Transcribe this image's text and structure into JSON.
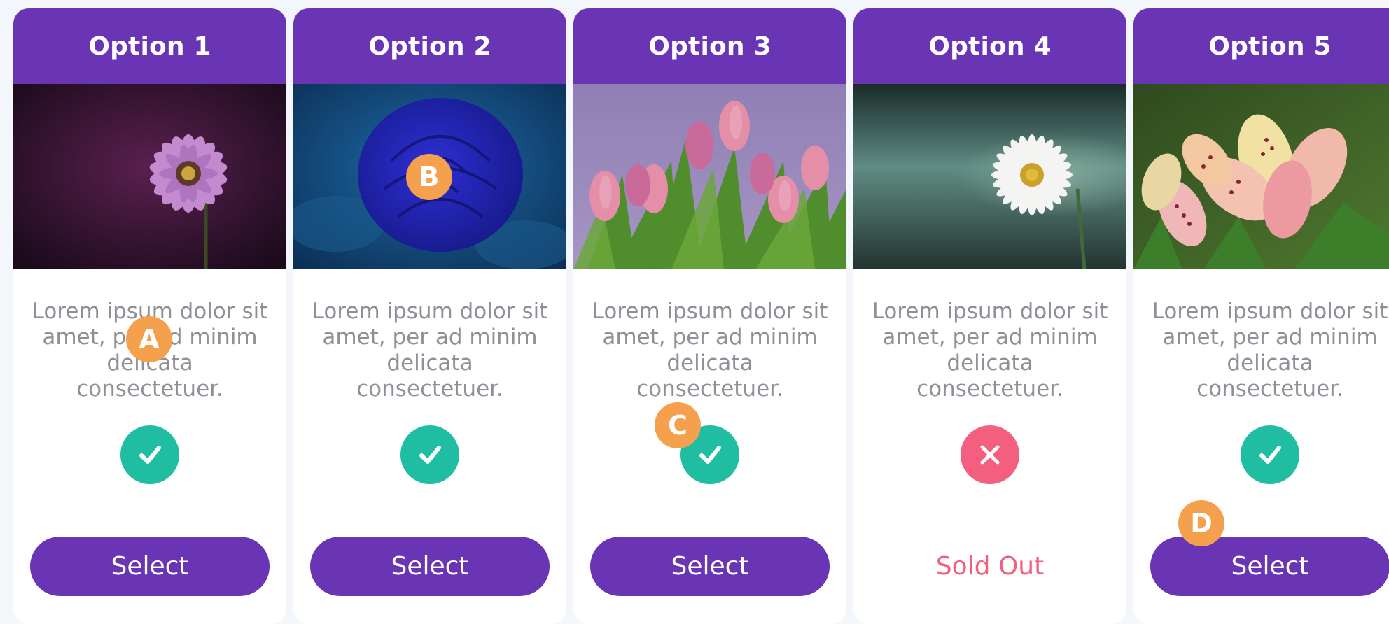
{
  "colors": {
    "primary": "#6a35b5",
    "success": "#1fbea2",
    "danger": "#f45f7f",
    "marker": "#f4a04c",
    "text_muted": "#8d9197",
    "page_bg": "#f3f6fb"
  },
  "cards": [
    {
      "title": "Option 1",
      "image": "purple-daisy-image",
      "description": "Lorem ipsum dolor sit amet, per ad minim delicata consectetuer.",
      "status": "available",
      "status_icon": "check-icon",
      "action_label": "Select"
    },
    {
      "title": "Option 2",
      "image": "blue-rose-image",
      "description": "Lorem ipsum dolor sit amet, per ad minim delicata consectetuer.",
      "status": "available",
      "status_icon": "check-icon",
      "action_label": "Select"
    },
    {
      "title": "Option 3",
      "image": "pink-tulips-image",
      "description": "Lorem ipsum dolor sit amet, per ad minim delicata consectetuer.",
      "status": "available",
      "status_icon": "check-icon",
      "action_label": "Select"
    },
    {
      "title": "Option 4",
      "image": "white-daisy-image",
      "description": "Lorem ipsum dolor sit amet, per ad minim delicata consectetuer.",
      "status": "sold-out",
      "status_icon": "x-icon",
      "action_label": "Sold Out"
    },
    {
      "title": "Option 5",
      "image": "lily-image",
      "description": "Lorem ipsum dolor sit amet, per ad minim delicata consectetuer.",
      "status": "available",
      "status_icon": "check-icon",
      "action_label": "Select"
    }
  ],
  "markers": [
    {
      "label": "A"
    },
    {
      "label": "B"
    },
    {
      "label": "C"
    },
    {
      "label": "D"
    }
  ]
}
